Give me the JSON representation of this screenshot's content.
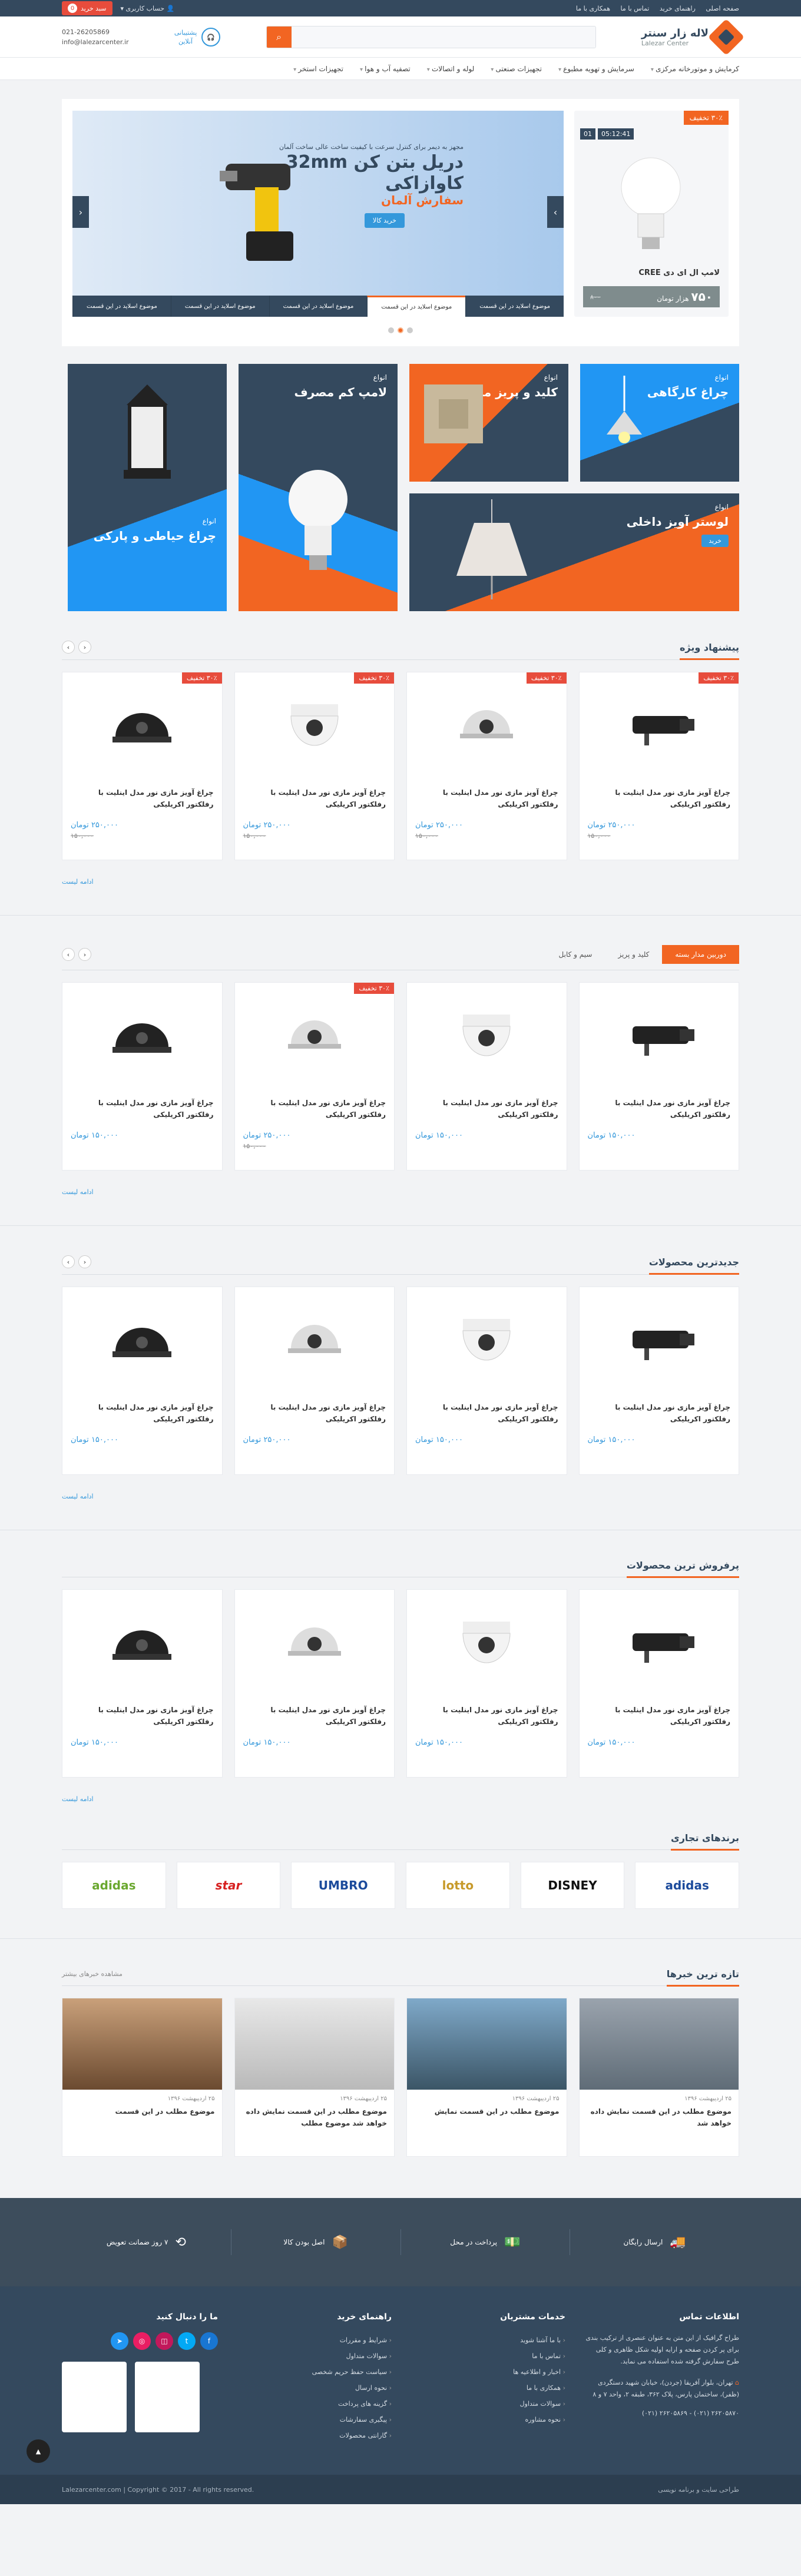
{
  "topbar": {
    "links": [
      "صفحه اصلی",
      "راهنمای خرید",
      "تماس با ما",
      "همکاری با ما"
    ],
    "account": "حساب کاربری",
    "cart_label": "سبد خرید",
    "cart_count": "0"
  },
  "header": {
    "logo_fa": "لاله زار سنتر",
    "logo_en": "Lalezar Center",
    "search_placeholder": "",
    "support_line1": "پشتیبانی",
    "support_line2": "آنلاین",
    "phone": "021-26205869",
    "email": "info@lalezarcenter.ir"
  },
  "nav": [
    "کرمایش و موتورخانه مرکزی",
    "سرمایش و تهویه مطبوع",
    "تجهیزات صنعتی",
    "لوله و اتصالات",
    "تصفیه آب و هوا",
    "تجهیزات استخر"
  ],
  "deal": {
    "badge": "۳۰٪ تخفیف",
    "days": "01",
    "time": "05:12:41",
    "name": "لامپ ال ای دی CREE",
    "price": "۷۵۰",
    "price_unit": "هزار تومان",
    "old_price": "۸۰۰"
  },
  "slider": {
    "sub": "مجهز به دیمر برای کنترل سرعت با کیفیت ساخت عالی ساخت آلمان",
    "title1": "دریل بتن کن 32mm",
    "title2": "کاوازاکی",
    "sub2": "سفارش آلمان",
    "button": "خرید کالا",
    "tabs": [
      "موضوع اسلاید در این قسمت",
      "موضوع اسلاید در این قسمت",
      "موضوع اسلاید در این قسمت",
      "موضوع اسلاید در این قسمت",
      "موضوع اسلاید در این قسمت"
    ]
  },
  "banners": [
    {
      "kicker": "انواع",
      "title": "چراغ کارگاهی"
    },
    {
      "kicker": "انواع",
      "title": "کلید و پریز متدو"
    },
    {
      "kicker": "انواع",
      "title": "لامپ کم مصرف"
    },
    {
      "kicker": "انواع",
      "title": "چراغ حیاطی و پارکی"
    },
    {
      "kicker": "انواع",
      "title": "لوستر آویز داخلی",
      "button": "خرید"
    }
  ],
  "product_name": "چراغ آویز مازی نور مدل اینلیت با رفلکتور اکریلیکی",
  "currency": "تومان",
  "more_label": "ادامه لیست",
  "special": {
    "title": "پیشنهاد ویژه",
    "items": [
      {
        "badge": "۳۰٪ تخفیف",
        "price": "۲۵۰,۰۰۰",
        "old": "۱۵۰,۰۰۰"
      },
      {
        "badge": "۳۰٪ تخفیف",
        "price": "۲۵۰,۰۰۰",
        "old": "۱۵۰,۰۰۰"
      },
      {
        "badge": "۳۰٪ تخفیف",
        "price": "۲۵۰,۰۰۰",
        "old": "۱۵۰,۰۰۰"
      },
      {
        "badge": "۳۰٪ تخفیف",
        "price": "۲۵۰,۰۰۰",
        "old": "۱۵۰,۰۰۰"
      }
    ]
  },
  "cctv": {
    "tabs": [
      "دوربین مدار بسته",
      "کلید و پریز",
      "سیم و کابل"
    ],
    "items": [
      {
        "badge": "",
        "price": "۱۵۰,۰۰۰",
        "old": ""
      },
      {
        "badge": "",
        "price": "۱۵۰,۰۰۰",
        "old": ""
      },
      {
        "badge": "۳۰٪ تخفیف",
        "price": "۲۵۰,۰۰۰",
        "old": "۱۵۰,۰۰۰"
      },
      {
        "badge": "",
        "price": "۱۵۰,۰۰۰",
        "old": ""
      }
    ]
  },
  "newest": {
    "title": "جدیدترین محصولات",
    "items": [
      {
        "price": "۱۵۰,۰۰۰"
      },
      {
        "price": "۱۵۰,۰۰۰"
      },
      {
        "price": "۲۵۰,۰۰۰"
      },
      {
        "price": "۱۵۰,۰۰۰"
      }
    ]
  },
  "best": {
    "title": "پرفروش ترین محصولات",
    "items": [
      {
        "price": "۱۵۰,۰۰۰"
      },
      {
        "price": "۱۵۰,۰۰۰"
      },
      {
        "price": "۱۵۰,۰۰۰"
      },
      {
        "price": "۱۵۰,۰۰۰"
      }
    ]
  },
  "brands": {
    "title": "برندهای تجاری",
    "items": [
      "adidas",
      "DISNEY",
      "lotto",
      "UMBRO",
      "star",
      "adidas"
    ]
  },
  "news": {
    "title": "تازه ترین خبرها",
    "all": "مشاهده خبرهای بیشتر",
    "items": [
      {
        "date": "۲۵ اردیبهشت ۱۳۹۶",
        "title": "موضوع مطلب در این قسمت نمایش داده خواهد شد"
      },
      {
        "date": "۲۵ اردیبهشت ۱۳۹۶",
        "title": "موضوع مطلب در این قسمت نمایش"
      },
      {
        "date": "۲۵ اردیبهشت ۱۳۹۶",
        "title": "موضوع مطلب در این قسمت نمایش داده خواهد شد موضوع مطلب"
      },
      {
        "date": "۲۵ اردیبهشت ۱۳۹۶",
        "title": "موضوع مطلب در این قسمت"
      }
    ]
  },
  "features": [
    "ارسال رایگان",
    "پرداخت در محل",
    "اصل بودن کالا",
    "۷ روز ضمانت تعویض"
  ],
  "footer": {
    "contact_title": "اطلاعات تماس",
    "contact_text": "طراح گرافیک از این متن به عنوان عنصری از ترکیب بندی برای پر کردن صفحه و ارایه اولیه شکل ظاهری و کلی طرح سفارش گرفته شده استفاده می نماید.",
    "address": "تهران، بلوار آفریقا (جردن)، خیابان شهید دستگردی (ظفر)، ساختمان پارس، پلاک ۳۶۲، طبقه ۲، واحد ۷ و ۸",
    "phones": "(۰۲۱) ۲۶۲۰۵۸۶۹ - (۰۲۱) ۲۶۲۰۵۸۷۰",
    "services_title": "خدمات مشتریان",
    "services": [
      "با ما آشنا شوید",
      "تماس با ما",
      "اخبار و اطلاعیه ها",
      "همکاری با ما",
      "سوالات متداول",
      "نحوه مشاوره"
    ],
    "guide_title": "راهنمای خرید",
    "guide": [
      "شرایط و مقررات",
      "سوالات متداول",
      "سیاست حفظ حریم شخصی",
      "نحوه ارسال",
      "گزینه های پرداخت",
      "پیگیری سفارشات",
      "گارانتی محصولات"
    ],
    "follow_title": "ما را دنبال کنید",
    "copyright": "Lalezarcenter.com | Copyright © 2017 - All rights reserved.",
    "designer": "طراحی سایت و برنامه نویسی"
  }
}
